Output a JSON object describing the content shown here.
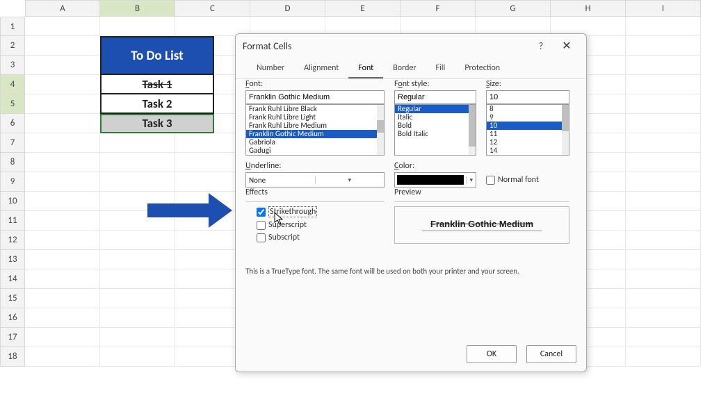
{
  "columns": [
    "A",
    "B",
    "C",
    "D",
    "E",
    "F",
    "G",
    "H",
    "I"
  ],
  "sel_col_idx": 1,
  "rows": [
    1,
    2,
    3,
    4,
    5,
    6,
    7,
    8,
    9,
    10,
    11,
    12,
    13,
    14,
    15,
    16,
    17,
    18
  ],
  "sel_row_idxs": [
    3,
    4
  ],
  "todo": {
    "title": "To Do List",
    "items": [
      "Task 1",
      "Task 2",
      "Task 3"
    ],
    "strike_idx": 0,
    "sel_idx": 2
  },
  "dialog": {
    "title": "Format Cells",
    "tabs": [
      "Number",
      "Alignment",
      "Font",
      "Border",
      "Fill",
      "Protection"
    ],
    "active_tab": 2,
    "font_label": "Font:",
    "font_value": "Franklin Gothic Medium",
    "font_list": [
      "Frank Ruhl Libre Black",
      "Frank Ruhl Libre Light",
      "Frank Ruhl Libre Medium",
      "Franklin Gothic Medium",
      "Gabriola",
      "Gadugi"
    ],
    "font_sel": "Franklin Gothic Medium",
    "style_label": "Font style:",
    "style_value": "Regular",
    "style_list": [
      "Regular",
      "Italic",
      "Bold",
      "Bold Italic"
    ],
    "style_sel": "Regular",
    "size_label": "Size:",
    "size_value": "10",
    "size_list": [
      "8",
      "9",
      "10",
      "11",
      "12",
      "14"
    ],
    "size_sel": "10",
    "underline_label": "Underline:",
    "underline_value": "None",
    "color_label": "Color:",
    "normal_font": "Normal font",
    "effects_label": "Effects",
    "strike": "Strikethrough",
    "superscript": "Superscript",
    "subscript": "Subscript",
    "preview_label": "Preview",
    "preview_text": "Franklin Gothic Medium",
    "note": "This is a TrueType font.  The same font will be used on both your printer and your screen.",
    "ok": "OK",
    "cancel": "Cancel",
    "help": "?",
    "close": "✕"
  }
}
